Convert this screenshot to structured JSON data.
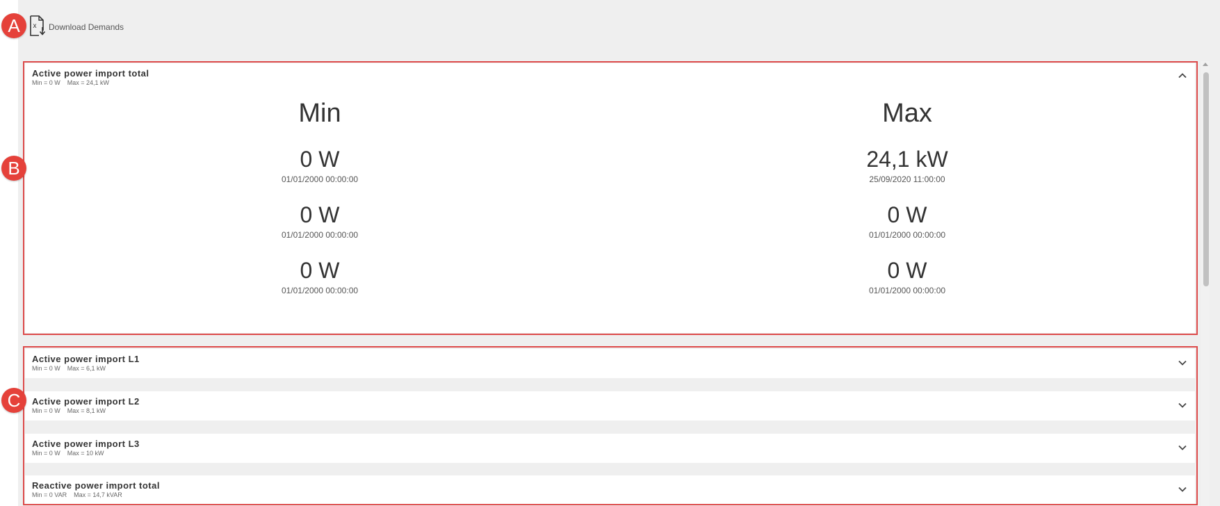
{
  "markers": {
    "a": "A",
    "b": "B",
    "c": "C"
  },
  "toolbar": {
    "download_label": "Download Demands"
  },
  "expanded_panel": {
    "title": "Active power import total",
    "min_summary": "Min = 0 W",
    "max_summary": "Max = 24,1 kW",
    "min_heading": "Min",
    "max_heading": "Max",
    "min_entries": [
      {
        "value": "0 W",
        "timestamp": "01/01/2000 00:00:00"
      },
      {
        "value": "0 W",
        "timestamp": "01/01/2000 00:00:00"
      },
      {
        "value": "0 W",
        "timestamp": "01/01/2000 00:00:00"
      }
    ],
    "max_entries": [
      {
        "value": "24,1 kW",
        "timestamp": "25/09/2020 11:00:00"
      },
      {
        "value": "0 W",
        "timestamp": "01/01/2000 00:00:00"
      },
      {
        "value": "0 W",
        "timestamp": "01/01/2000 00:00:00"
      }
    ]
  },
  "collapsed_panels": [
    {
      "title": "Active power import L1",
      "min_summary": "Min = 0 W",
      "max_summary": "Max = 6,1 kW"
    },
    {
      "title": "Active power import L2",
      "min_summary": "Min = 0 W",
      "max_summary": "Max = 8,1 kW"
    },
    {
      "title": "Active power import L3",
      "min_summary": "Min = 0 W",
      "max_summary": "Max = 10 kW"
    },
    {
      "title": "Reactive power import total",
      "min_summary": "Min = 0 VAR",
      "max_summary": "Max = 14,7 kVAR"
    }
  ],
  "icons": {
    "download": "excel-download-icon",
    "collapse": "chevron-up-icon",
    "expand": "chevron-down-icon"
  },
  "colors": {
    "highlight": "#dd4a4a",
    "marker": "#e5413a",
    "background": "#efefef"
  }
}
